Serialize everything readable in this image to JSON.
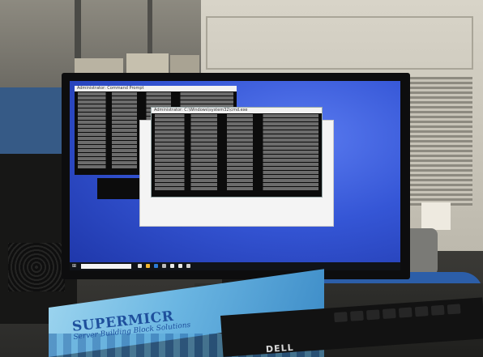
{
  "scene": {
    "supermicro_brand": "SUPERMICR",
    "supermicro_tagline": "Server Building Block Solutions",
    "keyboard_brand": "DELL"
  },
  "screen": {
    "front_window_title": "Administrator: C:\\Windows\\system32\\cmd.exe",
    "back_window_title": "Administrator: Command Prompt",
    "light_window_status": "",
    "taskbar_search_placeholder": "",
    "clock": ""
  },
  "colors": {
    "desktop_blue": "#3556d6",
    "console_bg": "#0c0c0c",
    "supermicro_blue": "#1e4f9c",
    "box_light_blue": "#6bb6e2"
  }
}
